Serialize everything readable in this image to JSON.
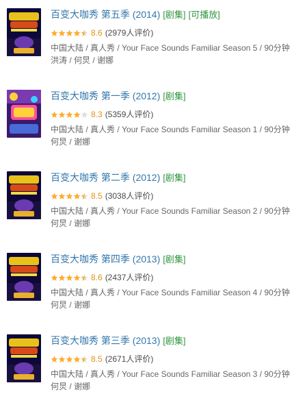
{
  "colors": {
    "title_link": "#3377aa",
    "tag_green": "#2e963d",
    "score_orange": "#e09015",
    "star_fill": "#ffac2d",
    "star_empty": "#dddddd",
    "meta_text": "#666666"
  },
  "items": [
    {
      "title": "百变大咖秀 第五季 (2014)",
      "tags": [
        "[剧集]",
        "[可播放]"
      ],
      "rating": 8.6,
      "score_text": "8.6",
      "votes_text": "(2979人评价)",
      "stars": 4.5,
      "info_line": "中国大陆 / 真人秀 / Your Face Sounds Familiar Season 5 / 90分钟",
      "people_line": "洪涛 / 何炅 / 谢娜",
      "poster_icon": "tv-show-poster-icon"
    },
    {
      "title": "百变大咖秀 第一季 (2012)",
      "tags": [
        "[剧集]"
      ],
      "rating": 8.3,
      "score_text": "8.3",
      "votes_text": "(5359人评价)",
      "stars": 4,
      "info_line": "中国大陆 / 真人秀 / Your Face Sounds Familiar Season 1 / 90分钟",
      "people_line": "何炅 / 谢娜",
      "poster_icon": "tv-show-poster-icon"
    },
    {
      "title": "百变大咖秀 第二季 (2012)",
      "tags": [
        "[剧集]"
      ],
      "rating": 8.5,
      "score_text": "8.5",
      "votes_text": "(3038人评价)",
      "stars": 4.5,
      "info_line": "中国大陆 / 真人秀 / Your Face Sounds Familiar Season 2 / 90分钟",
      "people_line": "何炅 / 谢娜",
      "poster_icon": "tv-show-poster-icon"
    },
    {
      "title": "百变大咖秀 第四季 (2013)",
      "tags": [
        "[剧集]"
      ],
      "rating": 8.6,
      "score_text": "8.6",
      "votes_text": "(2437人评价)",
      "stars": 4.5,
      "info_line": "中国大陆 / 真人秀 / Your Face Sounds Familiar Season 4 / 90分钟",
      "people_line": "何炅 / 谢娜",
      "poster_icon": "tv-show-poster-icon"
    },
    {
      "title": "百变大咖秀 第三季 (2013)",
      "tags": [
        "[剧集]"
      ],
      "rating": 8.5,
      "score_text": "8.5",
      "votes_text": "(2671人评价)",
      "stars": 4.5,
      "info_line": "中国大陆 / 真人秀 / Your Face Sounds Familiar Season 3 / 90分钟",
      "people_line": "何炅 / 谢娜",
      "poster_icon": "tv-show-poster-icon"
    }
  ]
}
